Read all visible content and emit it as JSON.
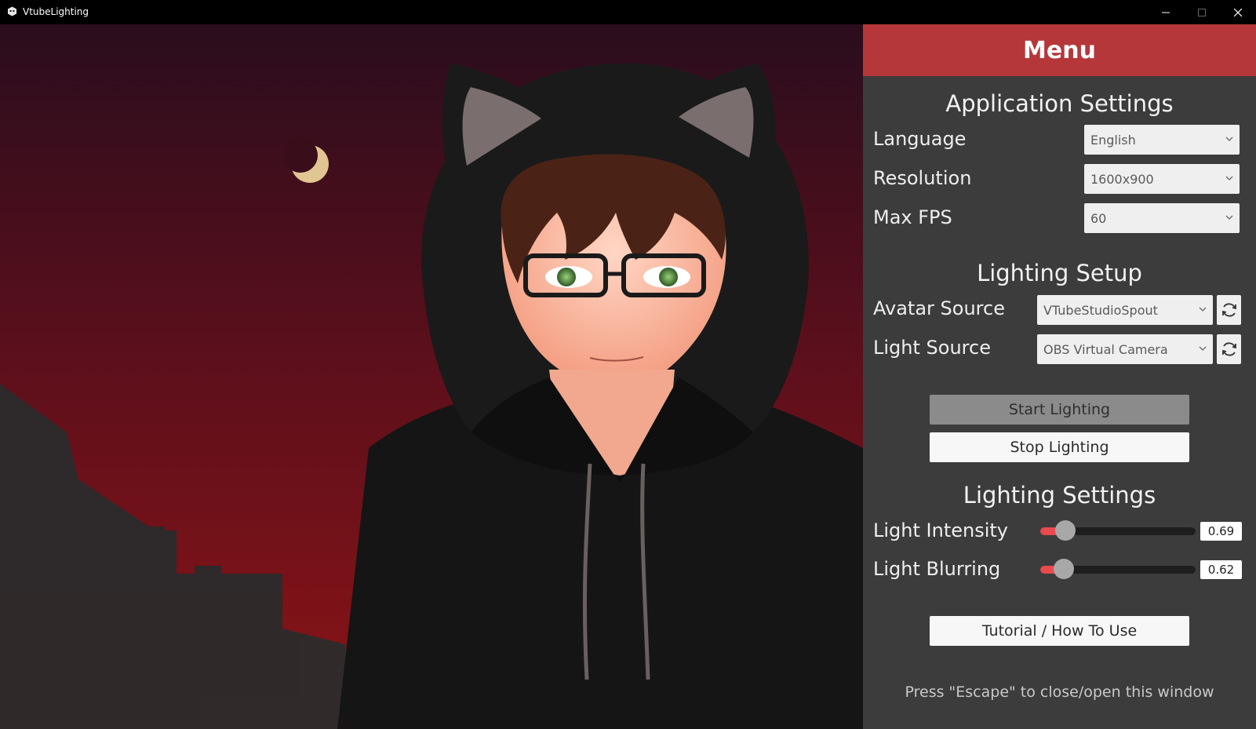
{
  "window": {
    "title": "VtubeLighting"
  },
  "menu": {
    "header": "Menu",
    "application_settings": {
      "title": "Application Settings",
      "language": {
        "label": "Language",
        "value": "English"
      },
      "resolution": {
        "label": "Resolution",
        "value": "1600x900"
      },
      "max_fps": {
        "label": "Max FPS",
        "value": "60"
      }
    },
    "lighting_setup": {
      "title": "Lighting Setup",
      "avatar_source": {
        "label": "Avatar Source",
        "value": "VTubeStudioSpout"
      },
      "light_source": {
        "label": "Light Source",
        "value": "OBS Virtual Camera"
      },
      "start_label": "Start Lighting",
      "stop_label": "Stop Lighting"
    },
    "lighting_settings": {
      "title": "Lighting Settings",
      "intensity": {
        "label": "Light Intensity",
        "value": 0.69,
        "value_text": "0.69",
        "slider_fraction": 0.16
      },
      "blurring": {
        "label": "Light Blurring",
        "value": 0.62,
        "value_text": "0.62",
        "slider_fraction": 0.15
      }
    },
    "tutorial_label": "Tutorial / How To Use",
    "hint": "Press \"Escape\" to close/open this window"
  },
  "colors": {
    "header_red": "#b5373a",
    "panel_bg": "#3c3c3c",
    "slider_fill": "#e84a4f"
  },
  "icons": [
    "app-icon",
    "minimize-icon",
    "maximize-icon",
    "close-icon",
    "chevron-down-icon",
    "refresh-icon"
  ]
}
